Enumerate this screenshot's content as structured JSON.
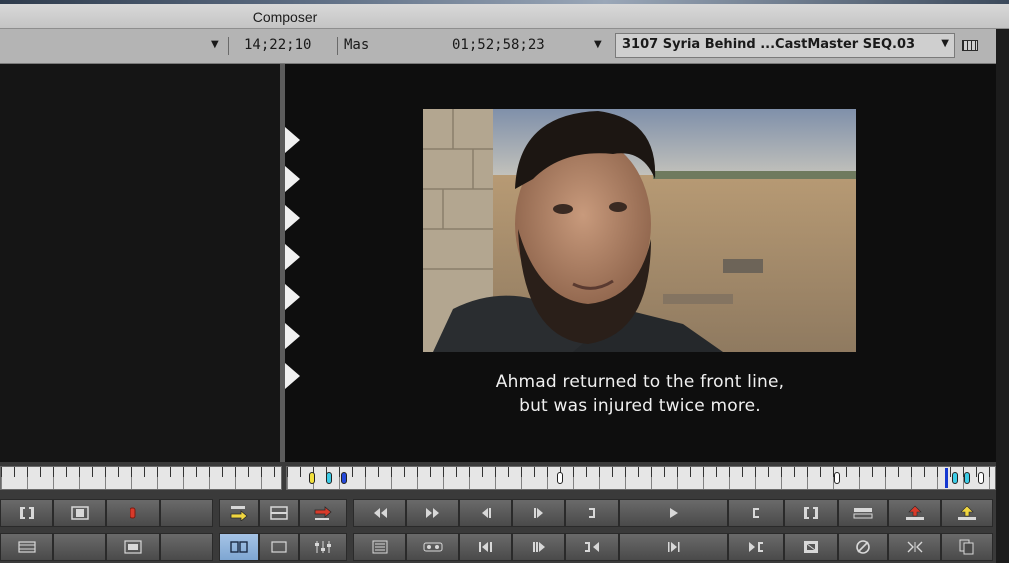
{
  "window": {
    "title": "Composer"
  },
  "timecode_bar": {
    "source_timecode": "14;22;10",
    "mark_label": "Mas",
    "record_timecode": "01;52;58;23",
    "sequence_name": "3107 Syria Behind ...CastMaster SEQ.03"
  },
  "record_monitor": {
    "caption_line1": "Ahmad returned to the front line,",
    "caption_line2": "but was injured twice more."
  },
  "colors": {
    "accent_selected": "#7ea6d2",
    "mark_in_yellow": "#f2e03c",
    "mark_cyan": "#3ccce6",
    "mark_blue": "#2448d8",
    "lift_red": "#d83a2a",
    "extract_yellow": "#f0d640"
  },
  "toolbar": {
    "row1": [
      {
        "icon": "mark-in-out-icon"
      },
      {
        "icon": "mark-clip-icon"
      },
      {
        "icon": "red-marker-icon"
      },
      {
        "icon": "blank"
      },
      {
        "icon": "splice-in-icon"
      },
      {
        "icon": "overwrite-icon"
      },
      {
        "icon": "overwrite-red-icon"
      },
      {
        "icon": "rewind-icon"
      },
      {
        "icon": "fast-forward-icon"
      },
      {
        "icon": "step-back-icon"
      },
      {
        "icon": "step-forward-icon"
      },
      {
        "icon": "mark-out-icon"
      },
      {
        "icon": "play-icon"
      },
      {
        "icon": "mark-in-icon"
      },
      {
        "icon": "mark-clip-icon"
      },
      {
        "icon": "trim-icon"
      },
      {
        "icon": "lift-icon"
      },
      {
        "icon": "extract-icon"
      }
    ],
    "row2": [
      {
        "icon": "film-icon"
      },
      {
        "icon": "blank"
      },
      {
        "icon": "film-frame-icon"
      },
      {
        "icon": "blank"
      },
      {
        "icon": "source-record-icon"
      },
      {
        "icon": "single-monitor-icon"
      },
      {
        "icon": "audio-mixer-icon"
      },
      {
        "icon": "bin-list-icon"
      },
      {
        "icon": "tape-icon"
      },
      {
        "icon": "step-back-fields-icon"
      },
      {
        "icon": "step-forward-fields-icon"
      },
      {
        "icon": "go-to-out-icon"
      },
      {
        "icon": "play-in-to-out-icon"
      },
      {
        "icon": "go-to-in-icon"
      },
      {
        "icon": "effect-icon"
      },
      {
        "icon": "clear-icon"
      },
      {
        "icon": "match-frame-icon"
      },
      {
        "icon": "copy-icon"
      }
    ]
  }
}
